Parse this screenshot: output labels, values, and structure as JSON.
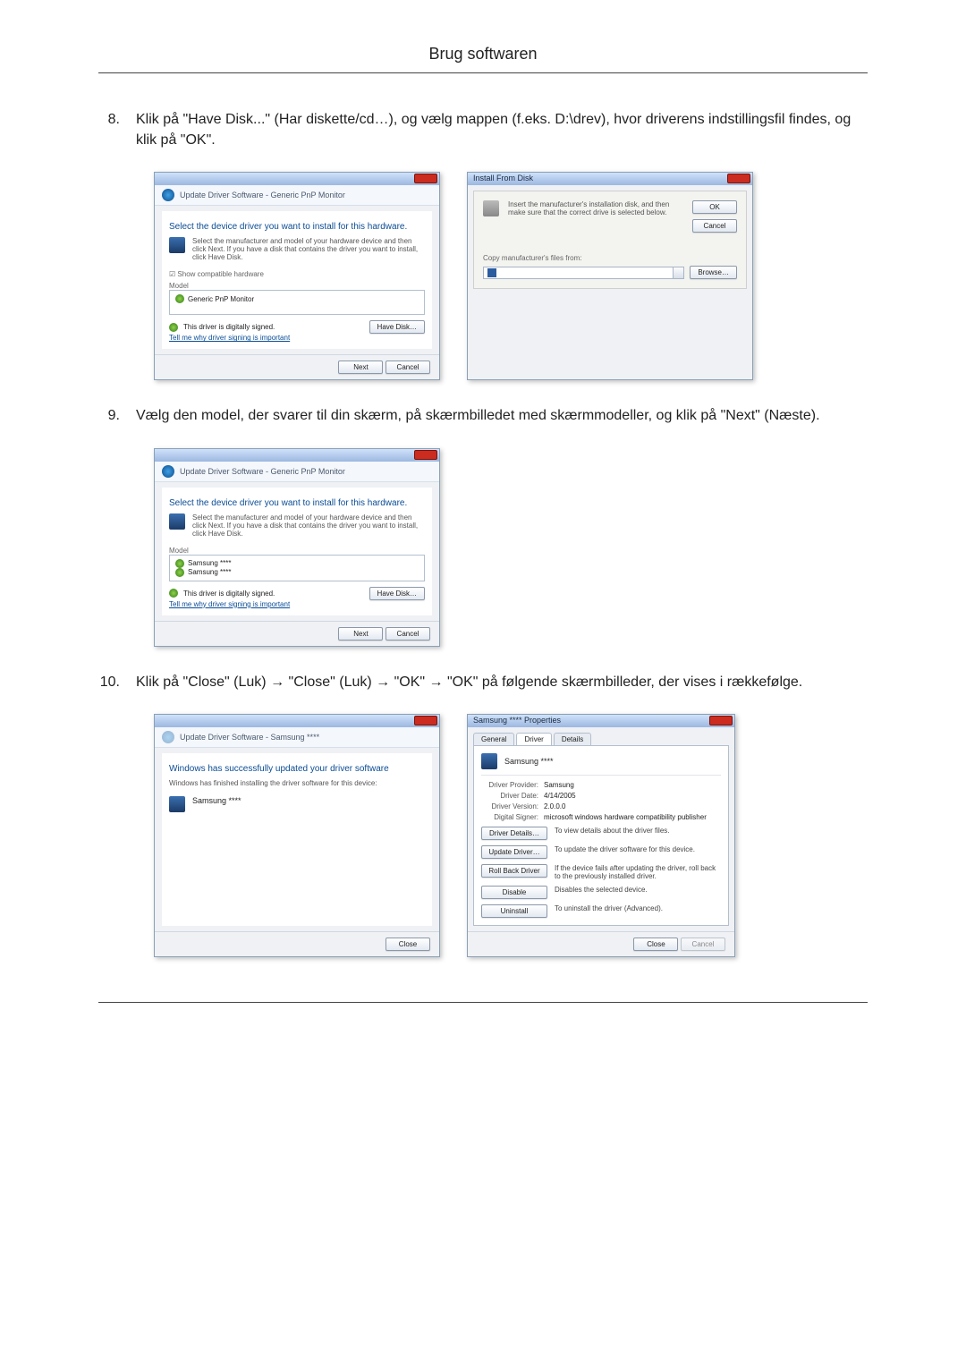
{
  "header": {
    "title": "Brug softwaren"
  },
  "steps": {
    "s8": {
      "num": "8.",
      "text": "Klik på \"Have Disk...\" (Har diskette/cd…), og vælg mappen (f.eks. D:\\drev), hvor driverens indstillingsfil findes, og klik på \"OK\"."
    },
    "s9": {
      "num": "9.",
      "text": "Vælg den model, der svarer til din skærm, på skærmbilledet med skærmmodeller, og klik på \"Next\" (Næste)."
    },
    "s10": {
      "num": "10.",
      "text": "Klik på \"Close\" (Luk) → \"Close\" (Luk) → \"OK\" → \"OK\" på følgende skærmbilleder, der vises i rækkefølge."
    }
  },
  "wizard1": {
    "crumb": "Update Driver Software - Generic PnP Monitor",
    "heading": "Select the device driver you want to install for this hardware.",
    "hint": "Select the manufacturer and model of your hardware device and then click Next. If you have a disk that contains the driver you want to install, click Have Disk.",
    "show_compat": "Show compatible hardware",
    "model_label": "Model",
    "model_item": "Generic PnP Monitor",
    "signed": "This driver is digitally signed.",
    "tell_me": "Tell me why driver signing is important",
    "have_disk": "Have Disk…",
    "next": "Next",
    "cancel": "Cancel"
  },
  "installFromDisk": {
    "title": "Install From Disk",
    "msg": "Insert the manufacturer's installation disk, and then make sure that the correct drive is selected below.",
    "ok": "OK",
    "cancel": "Cancel",
    "copy_label": "Copy manufacturer's files from:",
    "browse": "Browse…"
  },
  "wizard2": {
    "crumb": "Update Driver Software - Generic PnP Monitor",
    "heading": "Select the device driver you want to install for this hardware.",
    "hint": "Select the manufacturer and model of your hardware device and then click Next. If you have a disk that contains the driver you want to install, click Have Disk.",
    "model_label": "Model",
    "model_item1": "Samsung ****",
    "model_item2": "Samsung ****",
    "signed": "This driver is digitally signed.",
    "tell_me": "Tell me why driver signing is important",
    "have_disk": "Have Disk…",
    "next": "Next",
    "cancel": "Cancel"
  },
  "wizard3": {
    "crumb": "Update Driver Software - Samsung ****",
    "heading": "Windows has successfully updated your driver software",
    "sub": "Windows has finished installing the driver software for this device:",
    "device": "Samsung ****",
    "close": "Close"
  },
  "props": {
    "title": "Samsung **** Properties",
    "tabs": {
      "general": "General",
      "driver": "Driver",
      "details": "Details"
    },
    "device": "Samsung ****",
    "provider_lbl": "Driver Provider:",
    "provider": "Samsung",
    "date_lbl": "Driver Date:",
    "date": "4/14/2005",
    "version_lbl": "Driver Version:",
    "version": "2.0.0.0",
    "signer_lbl": "Digital Signer:",
    "signer": "microsoft windows hardware compatibility publisher",
    "details_btn": "Driver Details…",
    "details_desc": "To view details about the driver files.",
    "update_btn": "Update Driver…",
    "update_desc": "To update the driver software for this device.",
    "rollback_btn": "Roll Back Driver",
    "rollback_desc": "If the device fails after updating the driver, roll back to the previously installed driver.",
    "disable_btn": "Disable",
    "disable_desc": "Disables the selected device.",
    "uninstall_btn": "Uninstall",
    "uninstall_desc": "To uninstall the driver (Advanced).",
    "close": "Close",
    "cancel": "Cancel"
  }
}
